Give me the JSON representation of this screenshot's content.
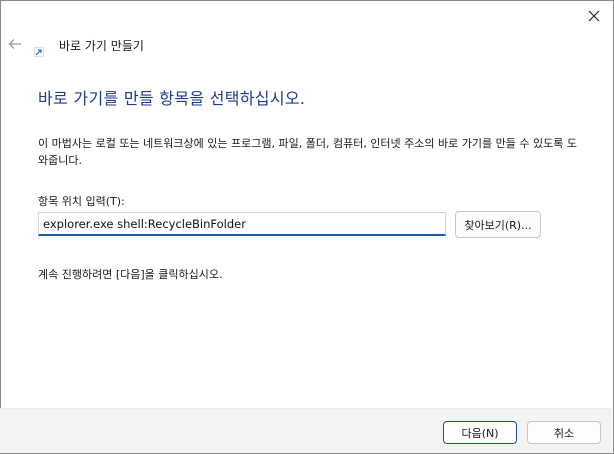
{
  "window": {
    "title": "바로 가기 만들기",
    "close_icon": "close-icon",
    "back_icon": "back-arrow-icon",
    "app_icon": "shortcut-wizard-icon"
  },
  "content": {
    "heading": "바로 가기를 만들 항목을 선택하십시오.",
    "description": "이 마법사는 로컬 또는 네트워크상에 있는 프로그램, 파일, 폴더, 컴퓨터, 인터넷 주소의 바로 가기를 만들 수 있도록 도와줍니다.",
    "location_label": "항목 위치 입력(T):",
    "location_value": "explorer.exe shell:RecycleBinFolder",
    "browse_label": "찾아보기(R)...",
    "hint": "계속 진행하려면 [다음]을 클릭하십시오."
  },
  "footer": {
    "next_label": "다음(N)",
    "cancel_label": "취소"
  },
  "colors": {
    "heading": "#1e3a8a",
    "input_underline": "#1f5fa8",
    "default_button_border": "#1a4fa0",
    "footer_bg": "#f3f3f3"
  }
}
